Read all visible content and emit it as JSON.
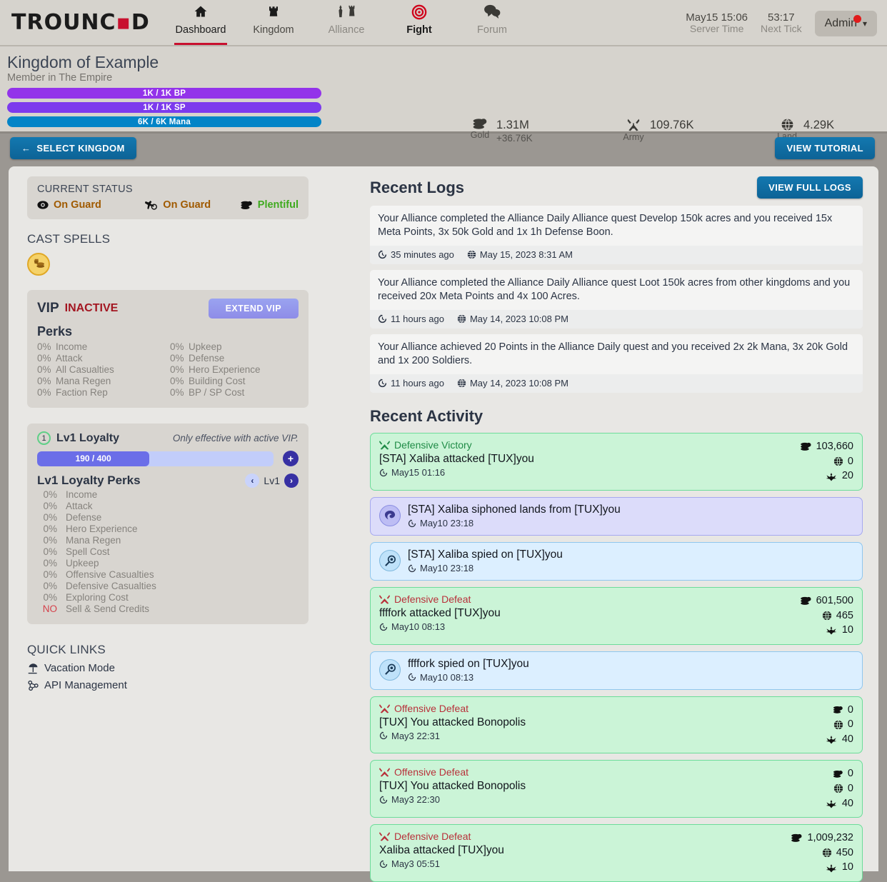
{
  "brand": {
    "text_before": "TROUNC",
    "dot": "▪",
    "text_after": "D"
  },
  "nav": {
    "items": [
      {
        "label": "Dashboard",
        "icon": "home-icon",
        "state": "active"
      },
      {
        "label": "Kingdom",
        "icon": "rook-icon",
        "state": "semi"
      },
      {
        "label": "Alliance",
        "icon": "chess-pieces-icon",
        "state": "dim"
      },
      {
        "label": "Fight",
        "icon": "target-icon",
        "state": "dark"
      },
      {
        "label": "Forum",
        "icon": "speech-bubbles-icon",
        "state": "dim"
      }
    ]
  },
  "header_right": {
    "server_time_value": "May15 15:06",
    "server_time_label": "Server Time",
    "next_tick_value": "53:17",
    "next_tick_label": "Next Tick",
    "admin_label": "Admin"
  },
  "kingdom": {
    "name": "Kingdom of Example",
    "membership": "Member in The Empire",
    "bars": [
      {
        "label": "1K / 1K BP",
        "color": "#9333ea",
        "pct": 100
      },
      {
        "label": "1K / 1K SP",
        "color": "#7c3aed",
        "pct": 100
      },
      {
        "label": "6K / 6K Mana",
        "color": "#0284c7",
        "pct": 100
      }
    ],
    "stats": [
      {
        "icon": "gold-coins-icon",
        "name": "Gold",
        "value": "1.31M",
        "sub": "+36.76K"
      },
      {
        "icon": "crossed-swords-icon",
        "name": "Army",
        "value": "109.76K",
        "sub": ""
      },
      {
        "icon": "globe-icon",
        "name": "Land",
        "value": "4.29K",
        "sub": ""
      }
    ]
  },
  "actionbar": {
    "select_kingdom": "SELECT KINGDOM",
    "back_arrow": "←",
    "view_tutorial": "VIEW TUTORIAL"
  },
  "current_status": {
    "title": "CURRENT STATUS",
    "items": [
      {
        "icon": "eye-icon",
        "label": "On Guard",
        "state": "guard"
      },
      {
        "icon": "spy-hand-icon",
        "label": "On Guard",
        "state": "guard"
      },
      {
        "icon": "coins-icon",
        "label": "Plentiful",
        "state": "plentiful"
      }
    ]
  },
  "cast_spells": {
    "title": "CAST SPELLS",
    "spell_icon": "gold-spell-icon"
  },
  "vip": {
    "title": "VIP",
    "status": "INACTIVE",
    "extend_label": "EXTEND VIP",
    "perks_title": "Perks",
    "perks": [
      {
        "value": "0%",
        "label": "Income"
      },
      {
        "value": "0%",
        "label": "Upkeep"
      },
      {
        "value": "0%",
        "label": "Attack"
      },
      {
        "value": "0%",
        "label": "Defense"
      },
      {
        "value": "0%",
        "label": "All Casualties"
      },
      {
        "value": "0%",
        "label": "Hero Experience"
      },
      {
        "value": "0%",
        "label": "Mana Regen"
      },
      {
        "value": "0%",
        "label": "Building Cost"
      },
      {
        "value": "0%",
        "label": "Faction Rep"
      },
      {
        "value": "0%",
        "label": "BP / SP Cost"
      }
    ]
  },
  "loyalty": {
    "badge": "1",
    "name": "Lv1 Loyalty",
    "note": "Only effective with active VIP.",
    "progress_label": "190 / 400",
    "progress_pct": 47.5,
    "plus_label": "+",
    "perks_title": "Lv1 Loyalty Perks",
    "level_label": "Lv1",
    "prev_arrow": "‹",
    "next_arrow": "›",
    "perks": [
      {
        "value": "0%",
        "label": "Income"
      },
      {
        "value": "0%",
        "label": "Attack"
      },
      {
        "value": "0%",
        "label": "Defense"
      },
      {
        "value": "0%",
        "label": "Hero Experience"
      },
      {
        "value": "0%",
        "label": "Mana Regen"
      },
      {
        "value": "0%",
        "label": "Spell Cost"
      },
      {
        "value": "0%",
        "label": "Upkeep"
      },
      {
        "value": "0%",
        "label": "Offensive Casualties"
      },
      {
        "value": "0%",
        "label": "Defensive Casualties"
      },
      {
        "value": "0%",
        "label": "Exploring Cost"
      },
      {
        "value": "NO",
        "label": "Sell & Send Credits",
        "no": true
      }
    ]
  },
  "quick_links": {
    "title": "QUICK LINKS",
    "items": [
      {
        "label": "Vacation Mode",
        "icon": "beach-umbrella-icon"
      },
      {
        "label": "API Management",
        "icon": "api-node-icon"
      }
    ]
  },
  "recent_logs": {
    "title": "Recent Logs",
    "view_full_label": "VIEW FULL LOGS",
    "entries": [
      {
        "text": "Your Alliance completed the Alliance Daily Alliance quest Develop 150k acres and you received 15x Meta Points, 3x 50k Gold and 1x 1h Defense Boon.",
        "relative": "35 minutes ago",
        "absolute": "May 15, 2023 8:31 AM"
      },
      {
        "text": "Your Alliance completed the Alliance Daily Alliance quest Loot 150k acres from other kingdoms and you received 20x Meta Points and 4x 100 Acres.",
        "relative": "11 hours ago",
        "absolute": "May 14, 2023 10:08 PM"
      },
      {
        "text": "Your Alliance achieved 20 Points in the Alliance Daily quest and you received 2x 2k Mana, 3x 20k Gold and 1x 200 Soldiers.",
        "relative": "11 hours ago",
        "absolute": "May 14, 2023 10:08 PM"
      }
    ]
  },
  "recent_activity": {
    "title": "Recent Activity",
    "cards": [
      {
        "kind": "battle",
        "result": "Defensive Victory",
        "result_state": "win",
        "description": "[STA] Xaliba attacked [TUX]you",
        "time": "May15 01:16",
        "stats": [
          {
            "icon": "gold-coins-icon",
            "value": "103,660"
          },
          {
            "icon": "globe-icon",
            "value": "0"
          },
          {
            "icon": "soldiers-icon",
            "value": "20"
          }
        ]
      },
      {
        "kind": "siphon",
        "icon": "siphon-icon",
        "description": "[STA] Xaliba siphoned lands from [TUX]you",
        "time": "May10 23:18"
      },
      {
        "kind": "spy",
        "icon": "magnifier-spy-icon",
        "description": "[STA] Xaliba spied on [TUX]you",
        "time": "May10 23:18"
      },
      {
        "kind": "battle",
        "result": "Defensive Defeat",
        "result_state": "loss",
        "description": "ffffork attacked [TUX]you",
        "time": "May10 08:13",
        "stats": [
          {
            "icon": "gold-coins-icon",
            "value": "601,500"
          },
          {
            "icon": "globe-icon",
            "value": "465"
          },
          {
            "icon": "soldiers-icon",
            "value": "10"
          }
        ]
      },
      {
        "kind": "spy",
        "icon": "magnifier-spy-icon",
        "description": "ffffork spied on [TUX]you",
        "time": "May10 08:13"
      },
      {
        "kind": "battle",
        "result": "Offensive Defeat",
        "result_state": "loss",
        "description": "[TUX] You attacked Bonopolis",
        "time": "May3 22:31",
        "stats": [
          {
            "icon": "gold-coins-icon",
            "value": "0"
          },
          {
            "icon": "globe-icon",
            "value": "0"
          },
          {
            "icon": "soldiers-icon",
            "value": "40"
          }
        ]
      },
      {
        "kind": "battle",
        "result": "Offensive Defeat",
        "result_state": "loss",
        "description": "[TUX] You attacked Bonopolis",
        "time": "May3 22:30",
        "stats": [
          {
            "icon": "gold-coins-icon",
            "value": "0"
          },
          {
            "icon": "globe-icon",
            "value": "0"
          },
          {
            "icon": "soldiers-icon",
            "value": "40"
          }
        ]
      },
      {
        "kind": "battle",
        "result": "Defensive Defeat",
        "result_state": "loss",
        "description": "Xaliba attacked [TUX]you",
        "time": "May3 05:51",
        "stats": [
          {
            "icon": "gold-coins-icon",
            "value": "1,009,232"
          },
          {
            "icon": "globe-icon",
            "value": "450"
          },
          {
            "icon": "soldiers-icon",
            "value": "10"
          }
        ]
      }
    ]
  }
}
